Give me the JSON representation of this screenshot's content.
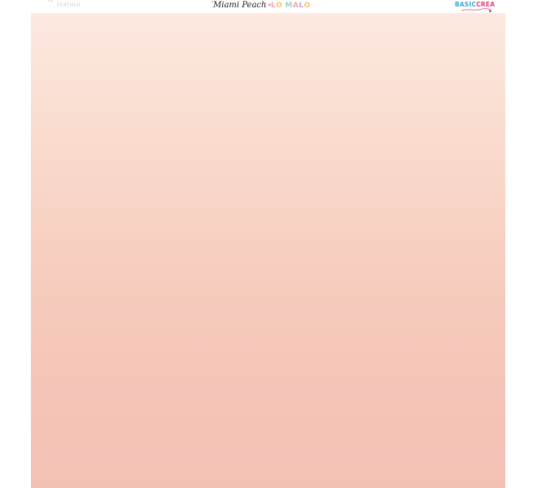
{
  "header": {
    "left_logo": "FEATHER",
    "title": "Miami Peach",
    "brand_mid": "LO MALO",
    "brand_right": "BASICCREA"
  },
  "colors": {
    "background": "#ffffff",
    "gradient_top": "#fce9e0",
    "gradient_bottom": "#f4c1b5",
    "title": "#1a1a1a",
    "accent_pink": "#e0457b",
    "accent_blue": "#3fa7d6"
  },
  "icons": {
    "title_star": "star-icon",
    "title_heart": "heart-icon",
    "left_crown": "crown-icon"
  }
}
